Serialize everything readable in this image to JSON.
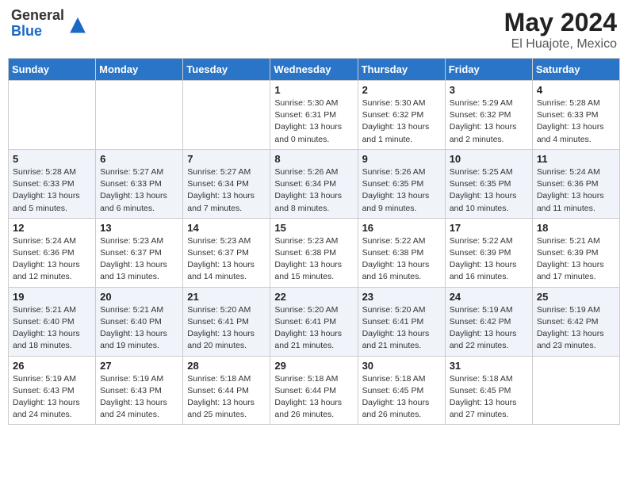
{
  "header": {
    "logo_general": "General",
    "logo_blue": "Blue",
    "main_title": "May 2024",
    "subtitle": "El Huajote, Mexico"
  },
  "weekdays": [
    "Sunday",
    "Monday",
    "Tuesday",
    "Wednesday",
    "Thursday",
    "Friday",
    "Saturday"
  ],
  "weeks": [
    [
      {
        "day": "",
        "info": ""
      },
      {
        "day": "",
        "info": ""
      },
      {
        "day": "",
        "info": ""
      },
      {
        "day": "1",
        "info": "Sunrise: 5:30 AM\nSunset: 6:31 PM\nDaylight: 13 hours\nand 0 minutes."
      },
      {
        "day": "2",
        "info": "Sunrise: 5:30 AM\nSunset: 6:32 PM\nDaylight: 13 hours\nand 1 minute."
      },
      {
        "day": "3",
        "info": "Sunrise: 5:29 AM\nSunset: 6:32 PM\nDaylight: 13 hours\nand 2 minutes."
      },
      {
        "day": "4",
        "info": "Sunrise: 5:28 AM\nSunset: 6:33 PM\nDaylight: 13 hours\nand 4 minutes."
      }
    ],
    [
      {
        "day": "5",
        "info": "Sunrise: 5:28 AM\nSunset: 6:33 PM\nDaylight: 13 hours\nand 5 minutes."
      },
      {
        "day": "6",
        "info": "Sunrise: 5:27 AM\nSunset: 6:33 PM\nDaylight: 13 hours\nand 6 minutes."
      },
      {
        "day": "7",
        "info": "Sunrise: 5:27 AM\nSunset: 6:34 PM\nDaylight: 13 hours\nand 7 minutes."
      },
      {
        "day": "8",
        "info": "Sunrise: 5:26 AM\nSunset: 6:34 PM\nDaylight: 13 hours\nand 8 minutes."
      },
      {
        "day": "9",
        "info": "Sunrise: 5:26 AM\nSunset: 6:35 PM\nDaylight: 13 hours\nand 9 minutes."
      },
      {
        "day": "10",
        "info": "Sunrise: 5:25 AM\nSunset: 6:35 PM\nDaylight: 13 hours\nand 10 minutes."
      },
      {
        "day": "11",
        "info": "Sunrise: 5:24 AM\nSunset: 6:36 PM\nDaylight: 13 hours\nand 11 minutes."
      }
    ],
    [
      {
        "day": "12",
        "info": "Sunrise: 5:24 AM\nSunset: 6:36 PM\nDaylight: 13 hours\nand 12 minutes."
      },
      {
        "day": "13",
        "info": "Sunrise: 5:23 AM\nSunset: 6:37 PM\nDaylight: 13 hours\nand 13 minutes."
      },
      {
        "day": "14",
        "info": "Sunrise: 5:23 AM\nSunset: 6:37 PM\nDaylight: 13 hours\nand 14 minutes."
      },
      {
        "day": "15",
        "info": "Sunrise: 5:23 AM\nSunset: 6:38 PM\nDaylight: 13 hours\nand 15 minutes."
      },
      {
        "day": "16",
        "info": "Sunrise: 5:22 AM\nSunset: 6:38 PM\nDaylight: 13 hours\nand 16 minutes."
      },
      {
        "day": "17",
        "info": "Sunrise: 5:22 AM\nSunset: 6:39 PM\nDaylight: 13 hours\nand 16 minutes."
      },
      {
        "day": "18",
        "info": "Sunrise: 5:21 AM\nSunset: 6:39 PM\nDaylight: 13 hours\nand 17 minutes."
      }
    ],
    [
      {
        "day": "19",
        "info": "Sunrise: 5:21 AM\nSunset: 6:40 PM\nDaylight: 13 hours\nand 18 minutes."
      },
      {
        "day": "20",
        "info": "Sunrise: 5:21 AM\nSunset: 6:40 PM\nDaylight: 13 hours\nand 19 minutes."
      },
      {
        "day": "21",
        "info": "Sunrise: 5:20 AM\nSunset: 6:41 PM\nDaylight: 13 hours\nand 20 minutes."
      },
      {
        "day": "22",
        "info": "Sunrise: 5:20 AM\nSunset: 6:41 PM\nDaylight: 13 hours\nand 21 minutes."
      },
      {
        "day": "23",
        "info": "Sunrise: 5:20 AM\nSunset: 6:41 PM\nDaylight: 13 hours\nand 21 minutes."
      },
      {
        "day": "24",
        "info": "Sunrise: 5:19 AM\nSunset: 6:42 PM\nDaylight: 13 hours\nand 22 minutes."
      },
      {
        "day": "25",
        "info": "Sunrise: 5:19 AM\nSunset: 6:42 PM\nDaylight: 13 hours\nand 23 minutes."
      }
    ],
    [
      {
        "day": "26",
        "info": "Sunrise: 5:19 AM\nSunset: 6:43 PM\nDaylight: 13 hours\nand 24 minutes."
      },
      {
        "day": "27",
        "info": "Sunrise: 5:19 AM\nSunset: 6:43 PM\nDaylight: 13 hours\nand 24 minutes."
      },
      {
        "day": "28",
        "info": "Sunrise: 5:18 AM\nSunset: 6:44 PM\nDaylight: 13 hours\nand 25 minutes."
      },
      {
        "day": "29",
        "info": "Sunrise: 5:18 AM\nSunset: 6:44 PM\nDaylight: 13 hours\nand 26 minutes."
      },
      {
        "day": "30",
        "info": "Sunrise: 5:18 AM\nSunset: 6:45 PM\nDaylight: 13 hours\nand 26 minutes."
      },
      {
        "day": "31",
        "info": "Sunrise: 5:18 AM\nSunset: 6:45 PM\nDaylight: 13 hours\nand 27 minutes."
      },
      {
        "day": "",
        "info": ""
      }
    ]
  ]
}
